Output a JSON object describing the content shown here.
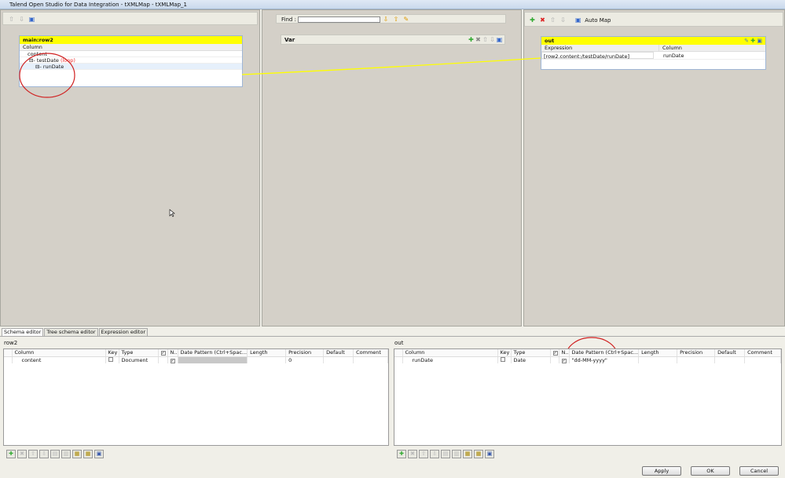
{
  "window": {
    "title": "Talend Open Studio for Data Integration - tXMLMap - tXMLMap_1"
  },
  "left": {
    "table_title": "main:row2",
    "column_header": "Column",
    "tree": [
      {
        "label": "content"
      },
      {
        "label": "testDate",
        "tag": "(loop)"
      },
      {
        "label": "runDate"
      }
    ]
  },
  "middle": {
    "find_label": "Find :",
    "find_value": "",
    "var_title": "Var"
  },
  "right": {
    "auto_map": "Auto Map",
    "table_title": "out",
    "headers": [
      "Expression",
      "Column"
    ],
    "rows": [
      {
        "expression": "[row2.content:/testDate/runDate]",
        "column": "runDate"
      }
    ]
  },
  "tabs": [
    "Schema editor",
    "Tree schema editor",
    "Expression editor"
  ],
  "schema_left": {
    "title": "row2",
    "headers": [
      "Column",
      "Key",
      "Type",
      "✓",
      "N..",
      "Date Pattern (Ctrl+Spac...",
      "Length",
      "Precision",
      "Default",
      "Comment"
    ],
    "rows": [
      {
        "column": "content",
        "key": false,
        "type": "Document",
        "nullable": true,
        "pattern": "",
        "length": "",
        "precision": "0",
        "default": "",
        "comment": ""
      }
    ]
  },
  "schema_right": {
    "title": "out",
    "headers": [
      "Column",
      "Key",
      "Type",
      "✓",
      "N..",
      "Date Pattern (Ctrl+Spac...",
      "Length",
      "Precision",
      "Default",
      "Comment"
    ],
    "rows": [
      {
        "column": "runDate",
        "key": false,
        "type": "Date",
        "nullable": true,
        "pattern": "\"dd-MM-yyyy\"",
        "length": "",
        "precision": "",
        "default": "",
        "comment": ""
      }
    ]
  },
  "buttons": {
    "apply": "Apply",
    "ok": "OK",
    "cancel": "Cancel"
  },
  "colors": {
    "header_yellow": "#ffff00",
    "link_line": "#ffff00",
    "annotation": "#d02020"
  }
}
